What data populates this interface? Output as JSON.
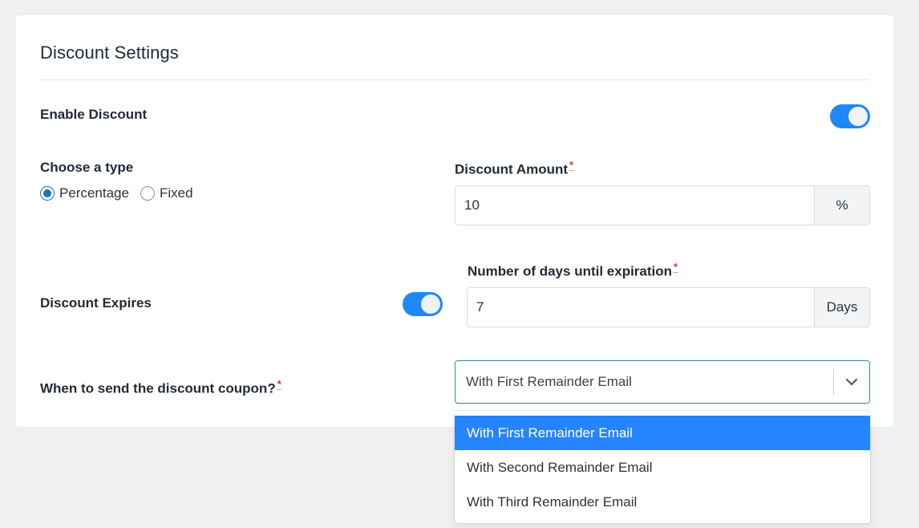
{
  "section": {
    "title": "Discount Settings"
  },
  "enable_discount": {
    "label": "Enable Discount",
    "enabled": true
  },
  "discount_type": {
    "label": "Choose a type",
    "options": [
      {
        "label": "Percentage",
        "checked": true
      },
      {
        "label": "Fixed",
        "checked": false
      }
    ]
  },
  "discount_amount": {
    "label": "Discount Amount",
    "required_mark": "*",
    "value": "10",
    "unit": "%"
  },
  "discount_expires": {
    "label": "Discount Expires",
    "enabled": true
  },
  "expiration_days": {
    "label": "Number of days until expiration",
    "required_mark": "*",
    "value": "7",
    "unit": "Days"
  },
  "send_coupon": {
    "label": "When to send the discount coupon?",
    "required_mark": "*",
    "selected": "With First Remainder Email",
    "options": [
      "With First Remainder Email",
      "With Second Remainder Email",
      "With Third Remainder Email"
    ],
    "active_option_index": 0
  },
  "colors": {
    "accent": "#1e88f5",
    "option_highlight": "#2684ff",
    "required": "#d63638",
    "select_border": "#2a8c9a"
  },
  "icons": {
    "dropdown": "chevron-down-icon"
  }
}
